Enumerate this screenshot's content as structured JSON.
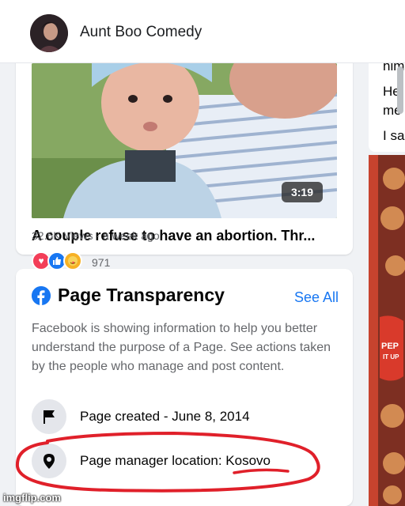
{
  "header": {
    "page_name": "Aunt Boo Comedy"
  },
  "video": {
    "duration": "3:19",
    "title": "A couple refuse to have an abortion. Thr...",
    "reaction_count": "971",
    "views_time": "32.6K Views · a week ago"
  },
  "transparency": {
    "title": "Page Transparency",
    "see_all": "See All",
    "description": "Facebook is showing information to help you better understand the purpose of a Page. See actions taken by the people who manage and post content.",
    "created_label": "Page created - June 8, 2014",
    "location_label": "Page manager location:",
    "location_value": "Kosovo"
  },
  "right_panel": {
    "lines": [
      "him",
      "He",
      "me",
      "I sa"
    ]
  },
  "watermark": "imgflip.com",
  "colors": {
    "accent": "#1877f2",
    "annotation": "#e0202a",
    "card_bg": "#ffffff",
    "page_bg": "#f0f2f5"
  },
  "icons": [
    "facebook-icon",
    "flag-icon",
    "location-pin-icon",
    "love-reaction-icon",
    "like-reaction-icon",
    "care-reaction-icon"
  ]
}
